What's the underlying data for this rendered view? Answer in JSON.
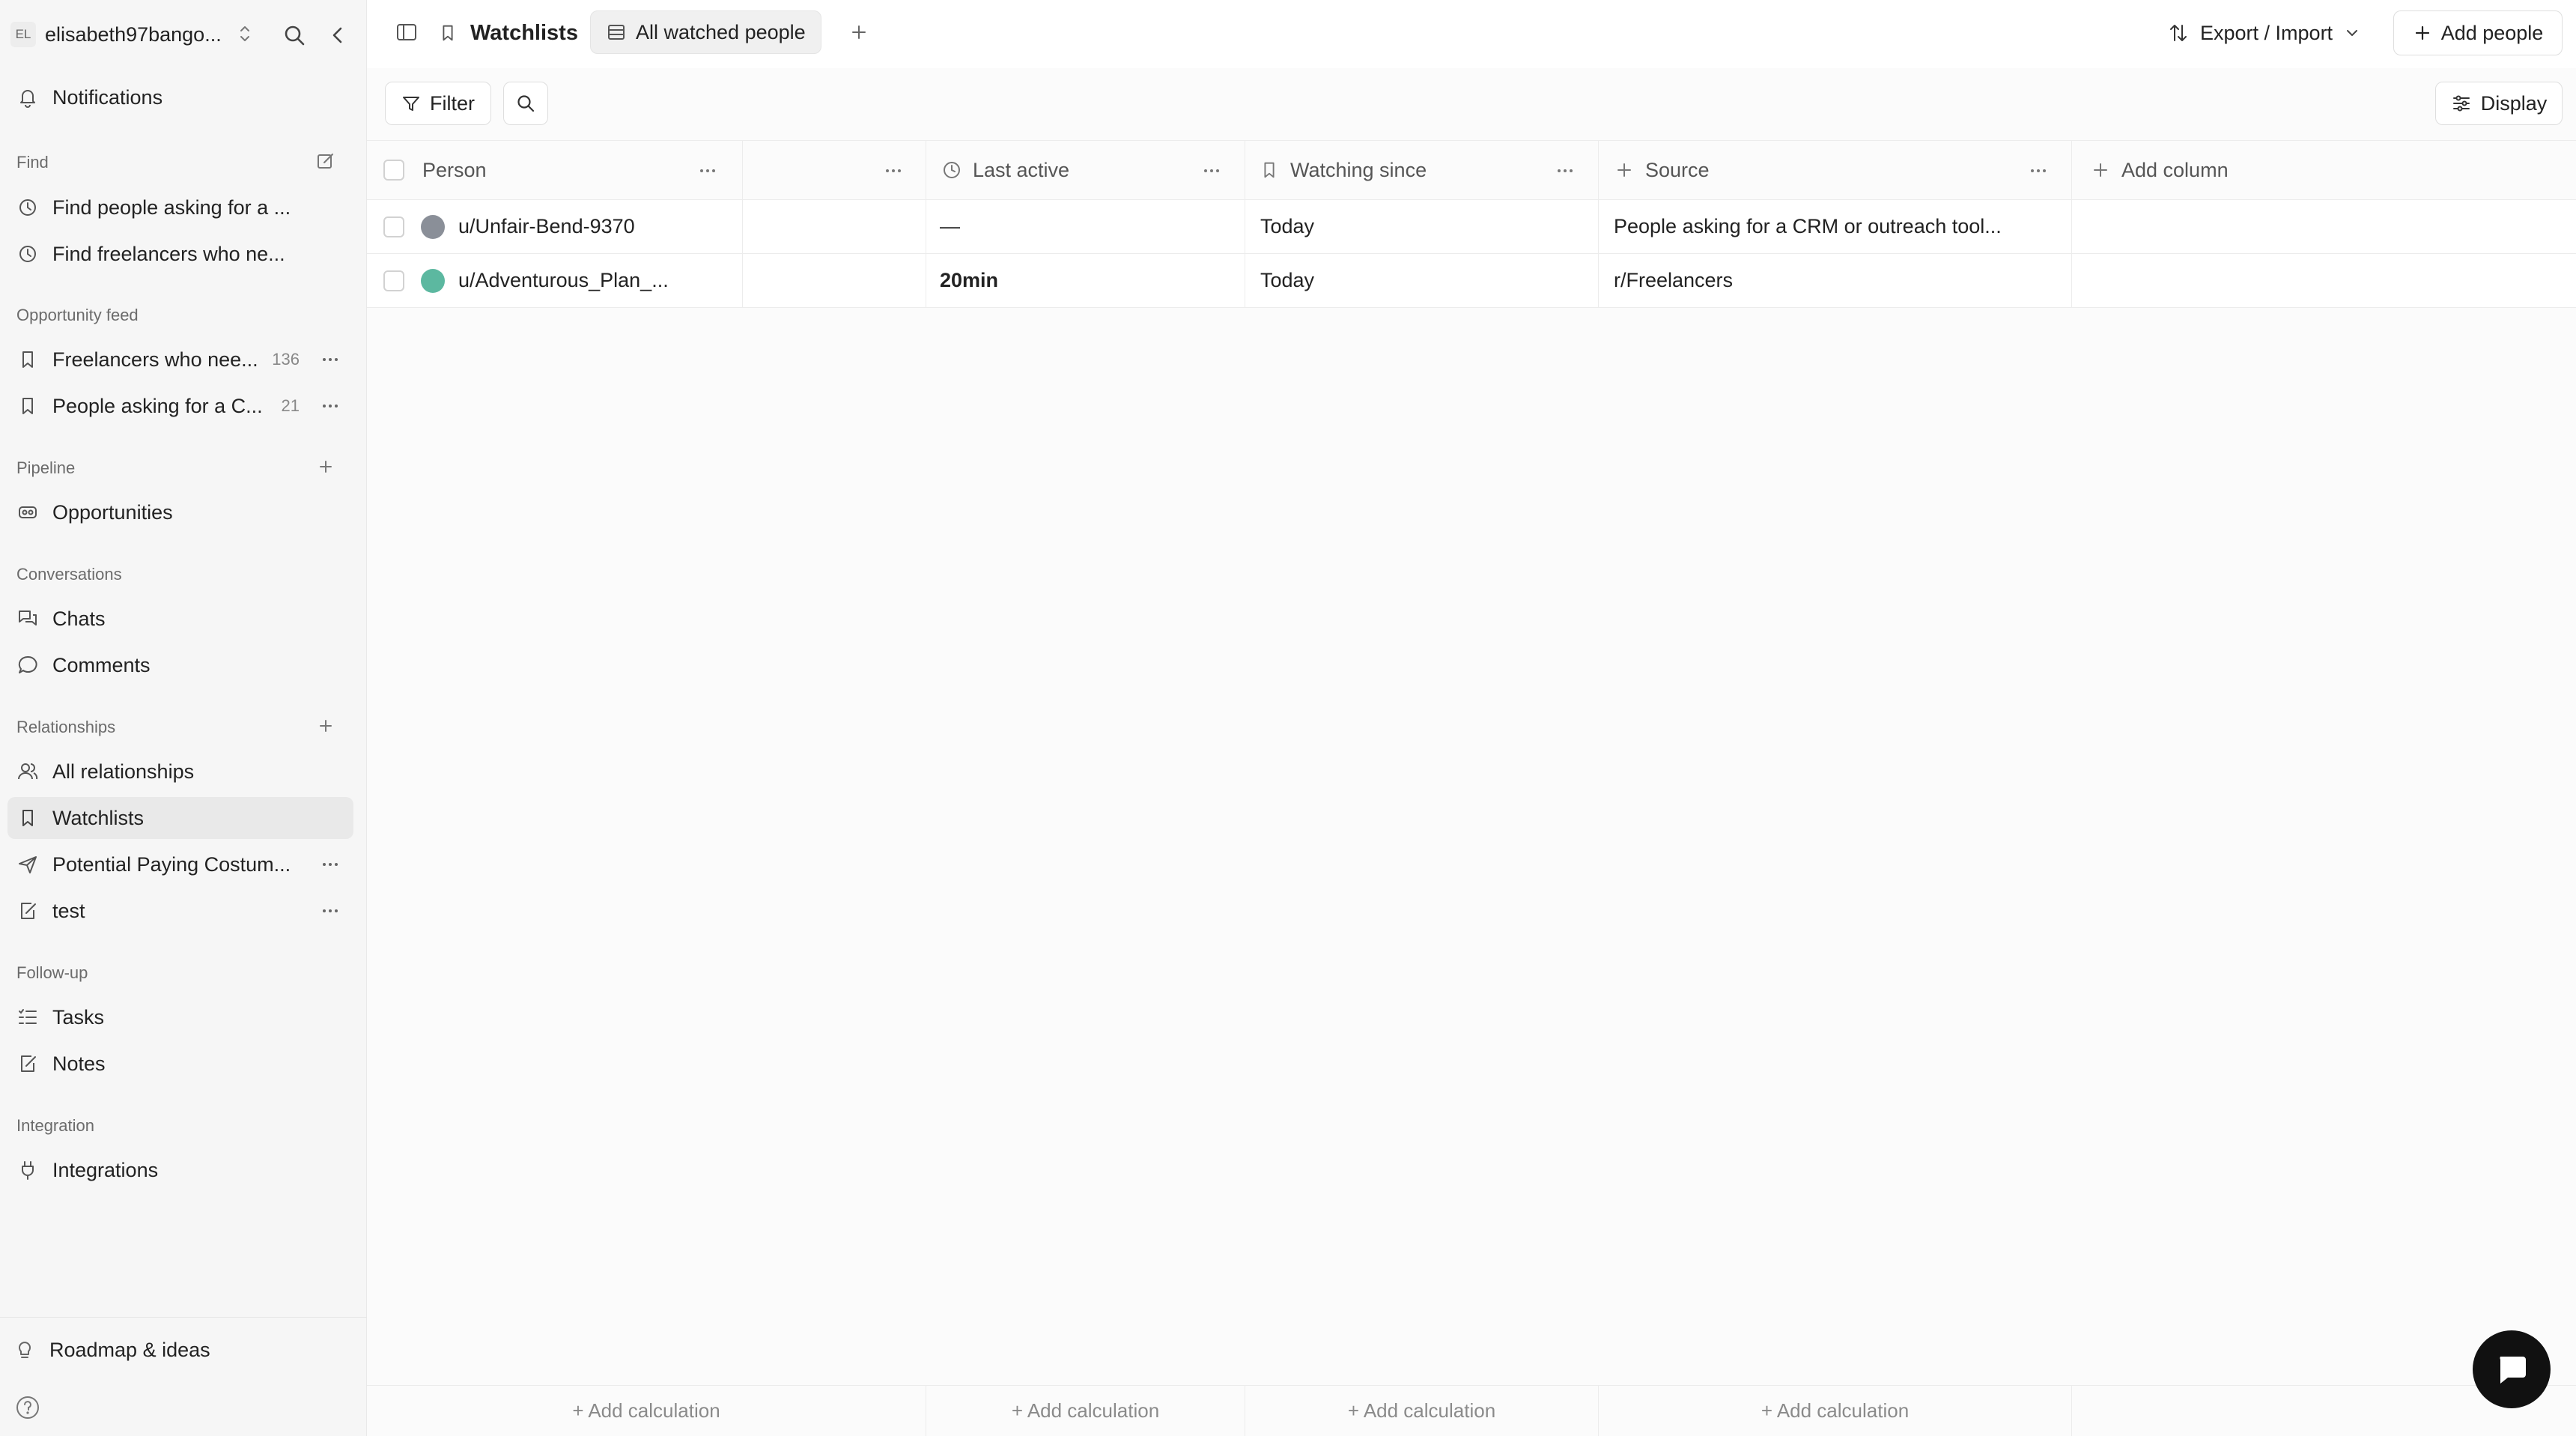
{
  "workspace": {
    "initials": "EL",
    "name": "elisabeth97bango..."
  },
  "sidebar": {
    "notifications": "Notifications",
    "find": {
      "label": "Find",
      "items": [
        "Find people asking for a ...",
        "Find freelancers who ne..."
      ]
    },
    "opportunity_feed": {
      "label": "Opportunity feed",
      "items": [
        {
          "label": "Freelancers who nee...",
          "count": "136"
        },
        {
          "label": "People asking for a C...",
          "count": "21"
        }
      ]
    },
    "pipeline": {
      "label": "Pipeline",
      "items": [
        "Opportunities"
      ]
    },
    "conversations": {
      "label": "Conversations",
      "items": [
        "Chats",
        "Comments"
      ]
    },
    "relationships": {
      "label": "Relationships",
      "items": [
        "All relationships",
        "Watchlists",
        "Potential Paying Costum...",
        "test"
      ]
    },
    "followup": {
      "label": "Follow-up",
      "items": [
        "Tasks",
        "Notes"
      ]
    },
    "integration": {
      "label": "Integration",
      "items": [
        "Integrations"
      ]
    },
    "bottom": {
      "roadmap": "Roadmap & ideas"
    }
  },
  "header": {
    "title": "Watchlists",
    "view_tab": "All watched people",
    "export_import": "Export / Import",
    "add_people": "Add people"
  },
  "toolbar": {
    "filter": "Filter",
    "display": "Display"
  },
  "table": {
    "columns": [
      "Person",
      "",
      "Last active",
      "Watching since",
      "Source"
    ],
    "add_column": "Add column",
    "rows": [
      {
        "person": "u/Unfair-Bend-9370",
        "last_active": "—",
        "watching_since": "Today",
        "source": "People asking for a CRM or outreach tool..."
      },
      {
        "person": "u/Adventurous_Plan_...",
        "last_active": "20min",
        "watching_since": "Today",
        "source": "r/Freelancers"
      }
    ],
    "add_calculation": "+ Add calculation"
  },
  "colors": {
    "accent": "#111111",
    "active_nav": "#e9e9e9",
    "avatar1": "#8a8f98",
    "avatar2": "#5cb8a0"
  }
}
